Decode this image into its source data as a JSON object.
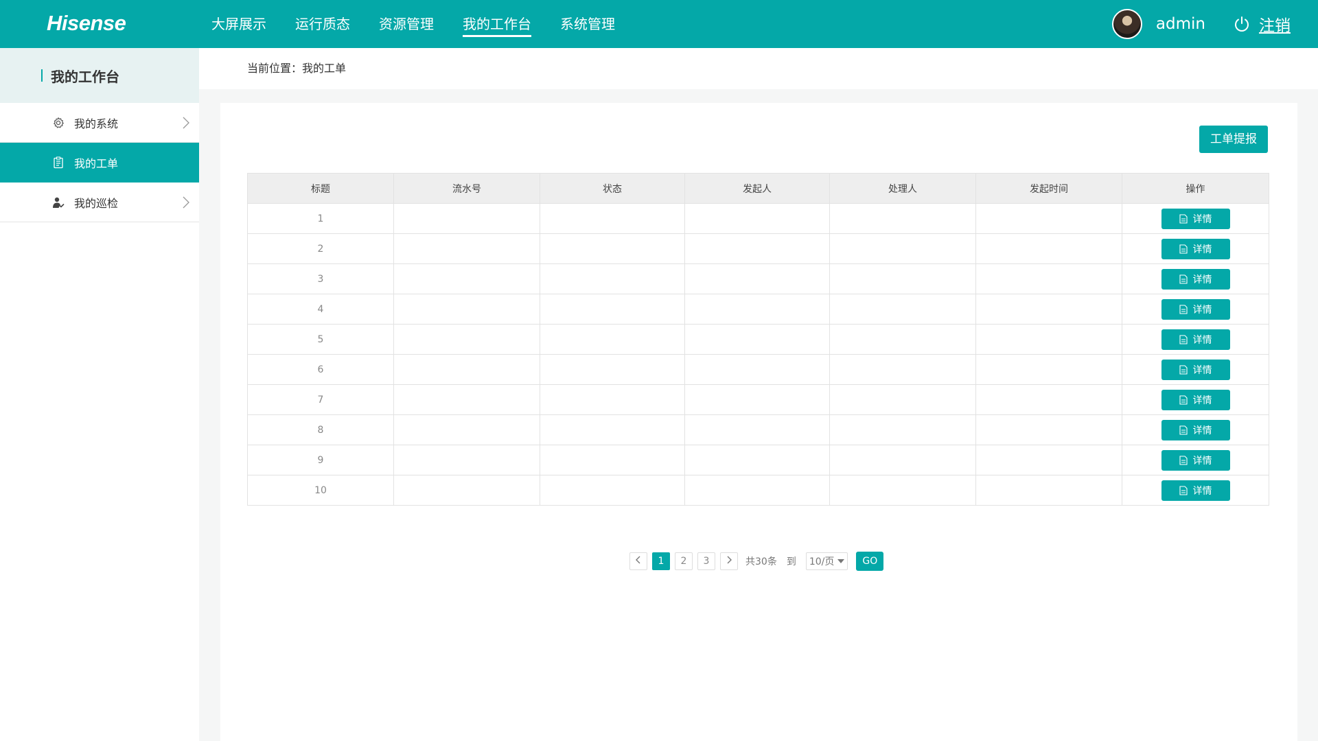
{
  "header": {
    "logo": "Hisense",
    "nav": [
      "大屏展示",
      "运行质态",
      "资源管理",
      "我的工作台",
      "系统管理"
    ],
    "active_nav": "我的工作台",
    "username": "admin",
    "logout": "注销"
  },
  "sidebar": {
    "title": "我的工作台",
    "items": [
      {
        "label": "我的系统",
        "icon": "gear-icon",
        "active": false
      },
      {
        "label": "我的工单",
        "icon": "clipboard-icon",
        "active": true
      },
      {
        "label": "我的巡检",
        "icon": "person-check-icon",
        "active": false
      }
    ]
  },
  "breadcrumb": "当前位置：我的工单",
  "toolbar": {
    "submit_label": "工单提报"
  },
  "table": {
    "columns": [
      "标题",
      "流水号",
      "状态",
      "发起人",
      "处理人",
      "发起时间",
      "操作"
    ],
    "rows": [
      {
        "title": "1",
        "serial": "",
        "status": "",
        "initiator": "",
        "handler": "",
        "time": ""
      },
      {
        "title": "2",
        "serial": "",
        "status": "",
        "initiator": "",
        "handler": "",
        "time": ""
      },
      {
        "title": "3",
        "serial": "",
        "status": "",
        "initiator": "",
        "handler": "",
        "time": ""
      },
      {
        "title": "4",
        "serial": "",
        "status": "",
        "initiator": "",
        "handler": "",
        "time": ""
      },
      {
        "title": "5",
        "serial": "",
        "status": "",
        "initiator": "",
        "handler": "",
        "time": ""
      },
      {
        "title": "6",
        "serial": "",
        "status": "",
        "initiator": "",
        "handler": "",
        "time": ""
      },
      {
        "title": "7",
        "serial": "",
        "status": "",
        "initiator": "",
        "handler": "",
        "time": ""
      },
      {
        "title": "8",
        "serial": "",
        "status": "",
        "initiator": "",
        "handler": "",
        "time": ""
      },
      {
        "title": "9",
        "serial": "",
        "status": "",
        "initiator": "",
        "handler": "",
        "time": ""
      },
      {
        "title": "10",
        "serial": "",
        "status": "",
        "initiator": "",
        "handler": "",
        "time": ""
      }
    ],
    "action_label": "详情"
  },
  "pagination": {
    "pages": [
      "1",
      "2",
      "3"
    ],
    "current": "1",
    "total": "共30条",
    "goto": "到",
    "page_size": "10/页",
    "go": "GO"
  },
  "colors": {
    "accent": "#04a8a8"
  }
}
